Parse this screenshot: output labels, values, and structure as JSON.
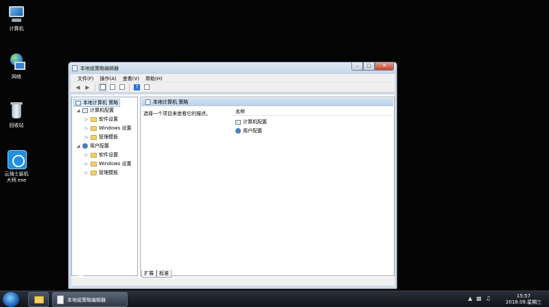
{
  "desktop": {
    "icons": [
      {
        "label": "计算机",
        "icon": "computer-icon"
      },
      {
        "label": "网络",
        "icon": "network-icon"
      },
      {
        "label": "回收站",
        "icon": "recycle-bin-icon"
      },
      {
        "label": "云骑士装机\n大师.exe",
        "icon": "app-icon"
      }
    ]
  },
  "window": {
    "title": "本地组策略编辑器",
    "buttons": {
      "minimize": "–",
      "maximize": "□",
      "close": "✕"
    },
    "menu": [
      "文件(F)",
      "操作(A)",
      "查看(V)",
      "帮助(H)"
    ],
    "tree": {
      "root": "本地计算机 策略",
      "computer_config": "计算机配置",
      "user_config": "用户配置",
      "children": [
        "软件设置",
        "Windows 设置",
        "管理模板"
      ]
    },
    "right": {
      "header": "本地计算机 策略",
      "description": "选择一个项目来查看它的描述。",
      "column_name": "名称",
      "items": [
        "计算机配置",
        "用户配置"
      ]
    },
    "tabs": [
      "扩展",
      "标准"
    ]
  },
  "taskbar": {
    "active_app": "本地组策略编辑器",
    "clock_time": "15:57",
    "clock_date": "2018.09.星期三"
  }
}
